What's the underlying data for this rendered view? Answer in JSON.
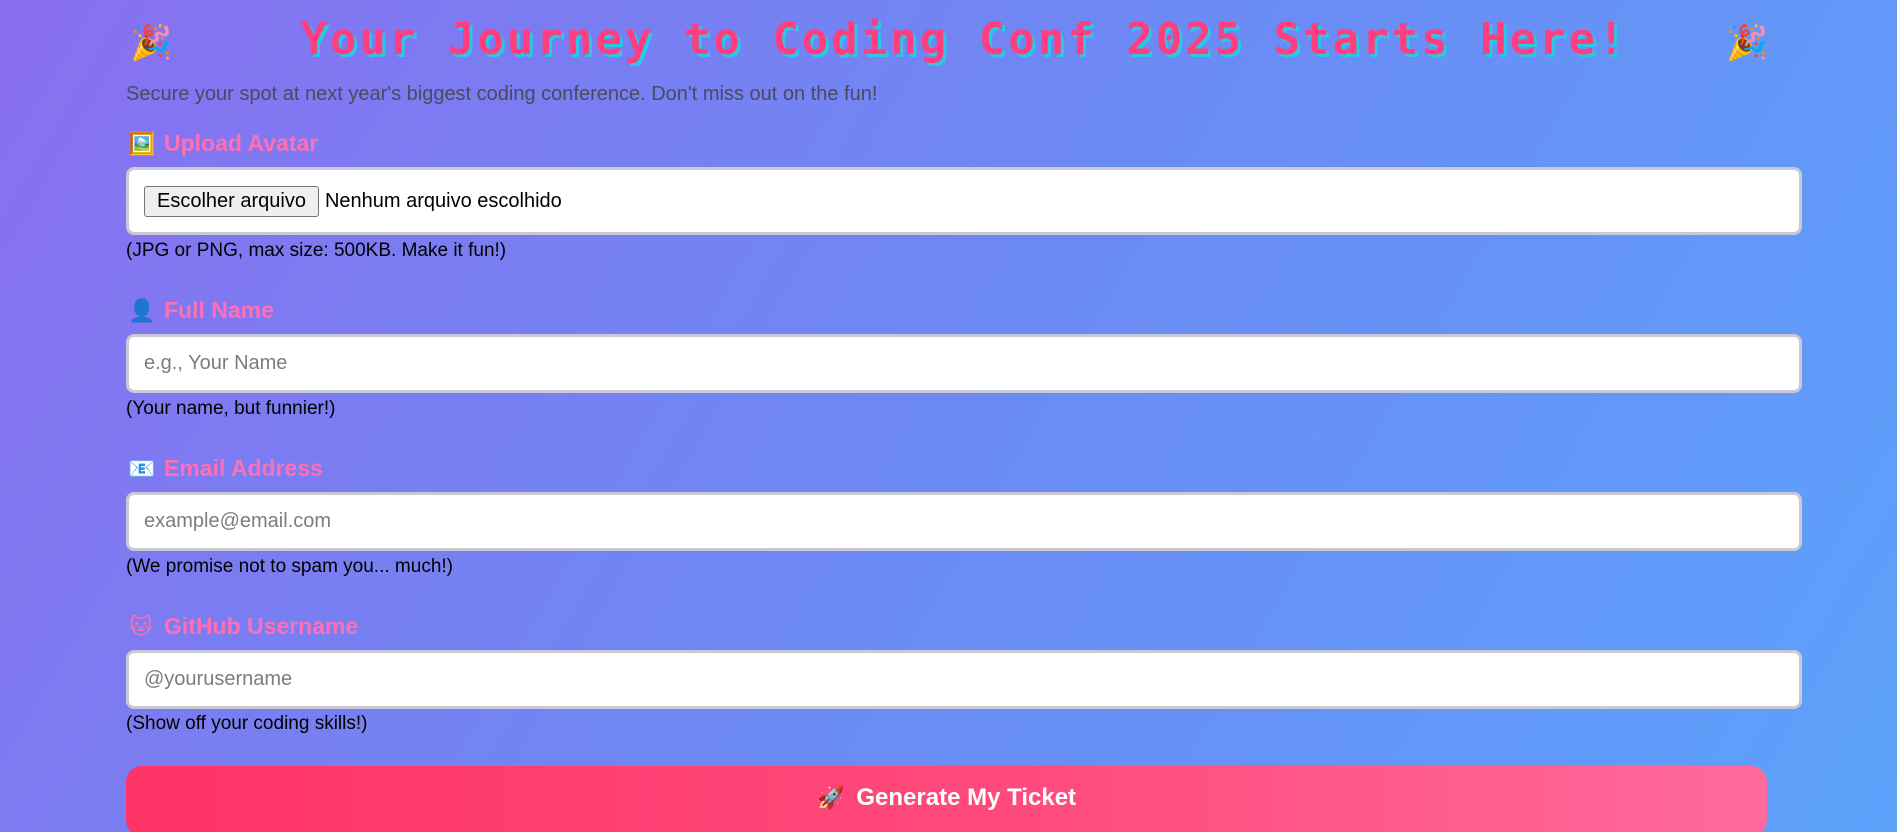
{
  "header": {
    "title": "Your Journey to Coding Conf 2025 Starts Here!",
    "left_emoji": "🎉",
    "right_emoji": "🎉",
    "subtitle": "Secure your spot at next year's biggest coding conference. Don't miss out on the fun!"
  },
  "form": {
    "avatar": {
      "icon": "🖼️",
      "label": "Upload Avatar",
      "button_label": "Escolher arquivo",
      "status": "Nenhum arquivo escolhido",
      "hint": "(JPG or PNG, max size: 500KB. Make it fun!)"
    },
    "full_name": {
      "icon": "👤",
      "label": "Full Name",
      "placeholder": "e.g., Your Name",
      "value": "",
      "hint": "(Your name, but funnier!)"
    },
    "email": {
      "icon": "📧",
      "label": "Email Address",
      "placeholder": "example@email.com",
      "value": "",
      "hint": "(We promise not to spam you... much!)"
    },
    "github": {
      "icon": "🐱",
      "label": "GitHub Username",
      "placeholder": "@yourusername",
      "value": "",
      "hint": "(Show off your coding skills!)"
    },
    "submit": {
      "icon": "🚀",
      "label": "Generate My Ticket"
    }
  },
  "colors": {
    "title": "#ff3d7f",
    "title_shadow": "#2bc8e6",
    "label": "#ff6fb5",
    "button_start": "#ff3366",
    "button_end": "#ff6a9c",
    "bg_start": "#8a6ff0",
    "bg_end": "#5ca2fb"
  }
}
